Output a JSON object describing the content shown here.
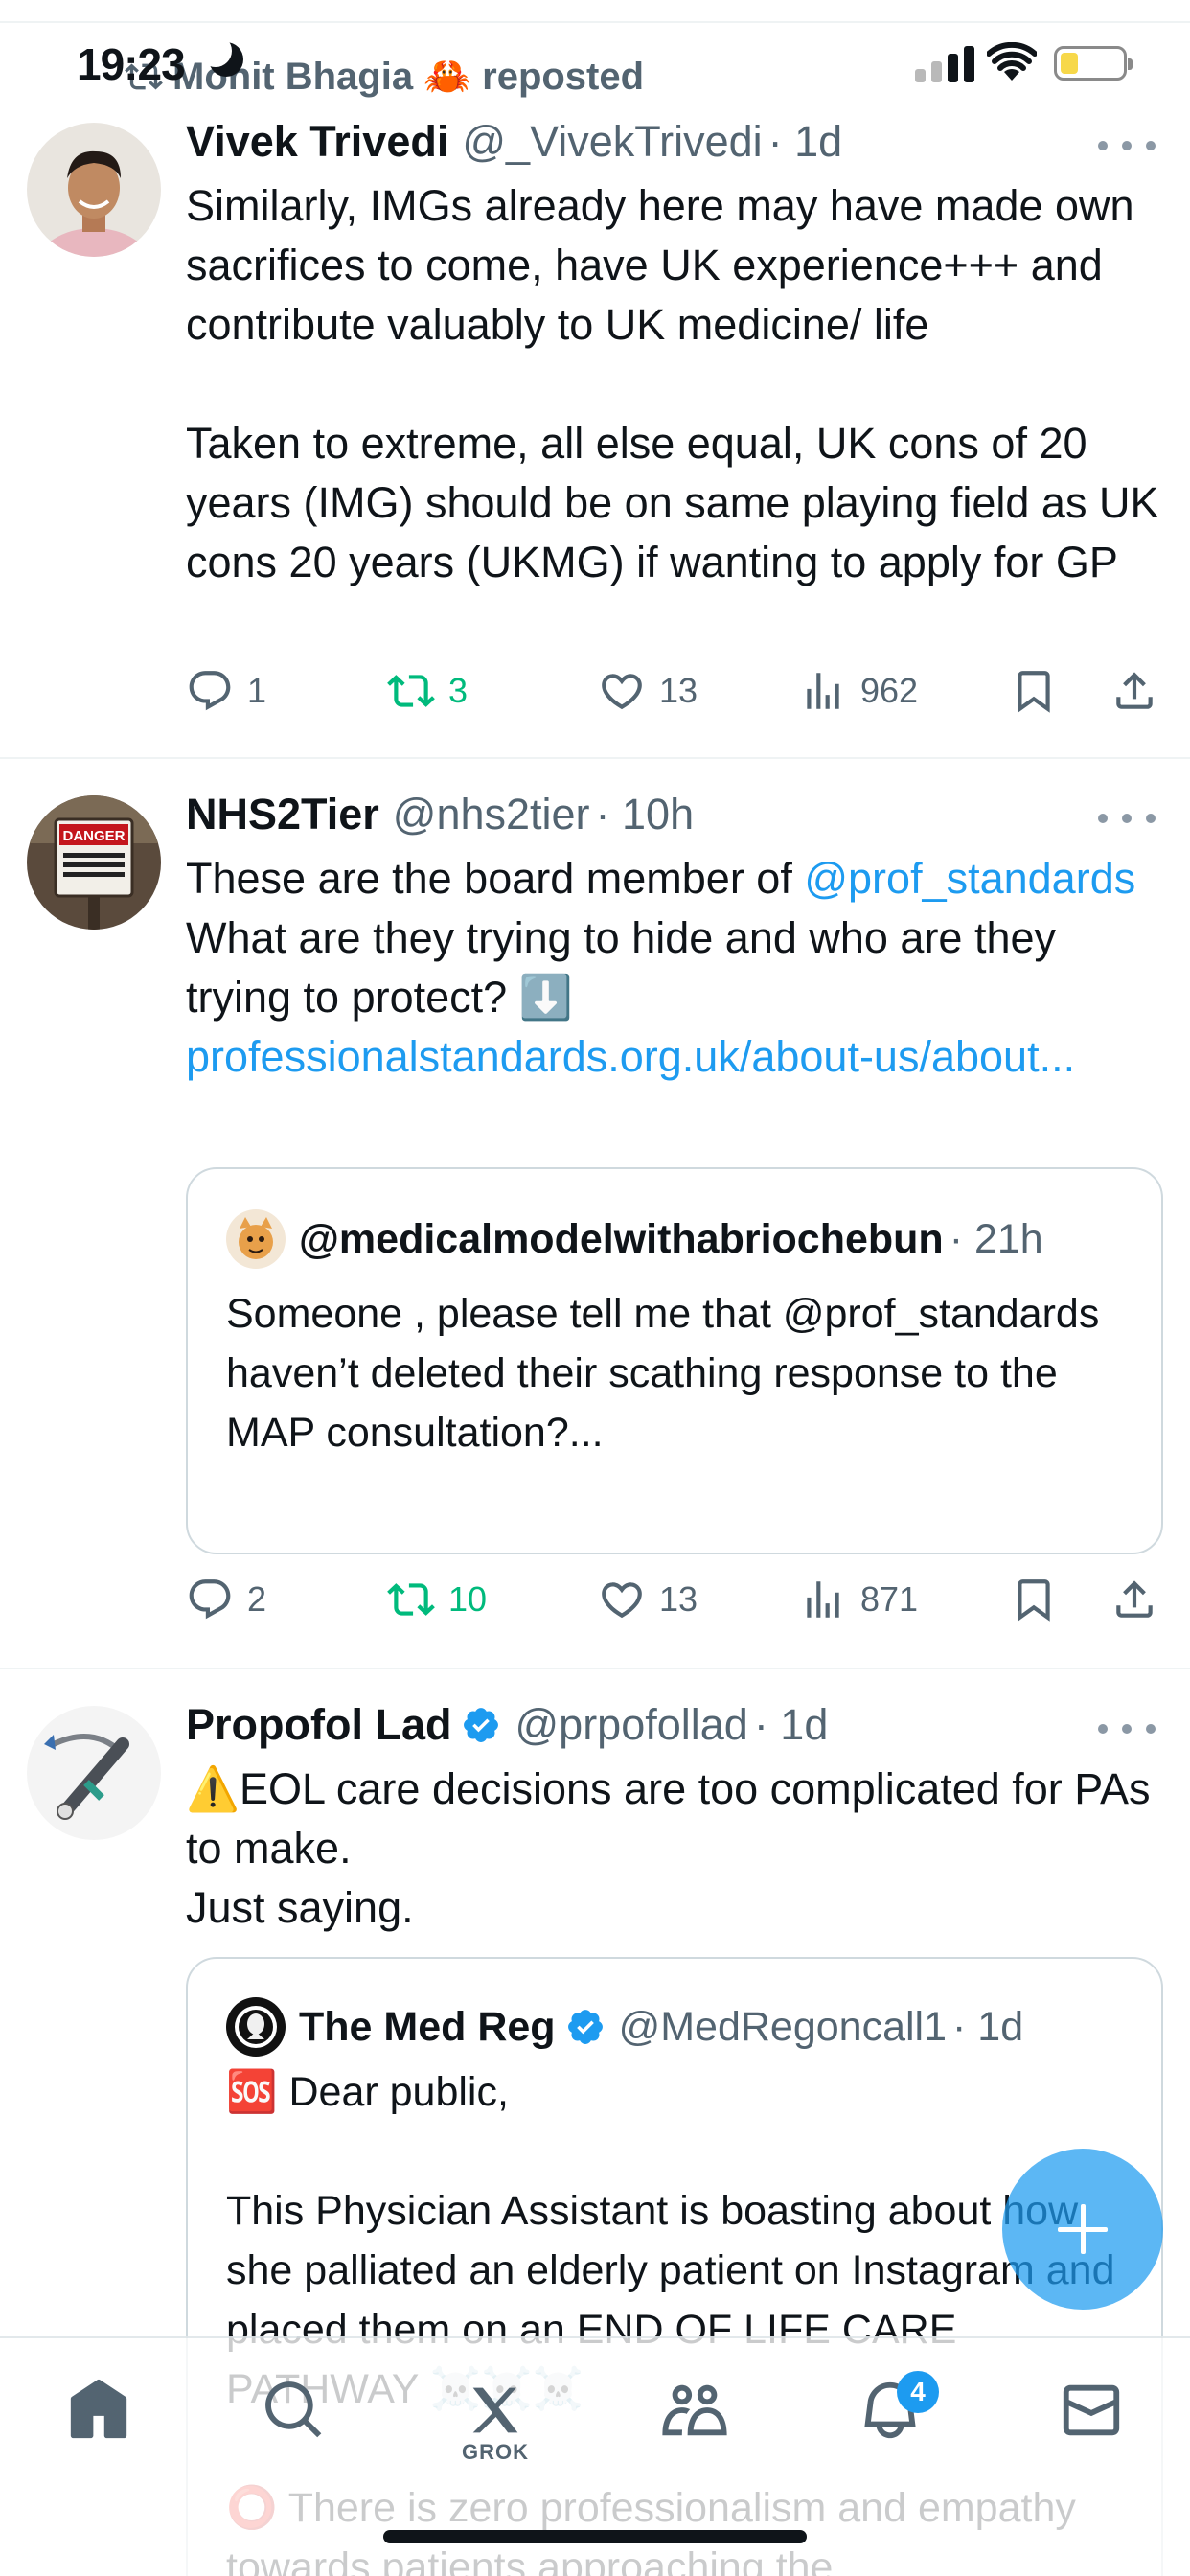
{
  "status_bar": {
    "time": "19:23"
  },
  "repost_banner": {
    "text": "Mohit Bhagia 🦀 reposted"
  },
  "posts": [
    {
      "name": "Vivek Trivedi",
      "handle": "@_VivekTrivedi",
      "time": "· 1d",
      "text": "Similarly, IMGs already here may have made own sacrifices to come, have UK experience+++ and contribute valuably to UK medicine/ life\n\nTaken to extreme, all else equal, UK cons of 20 years (IMG) should be on same playing field as UK cons 20 years (UKMG) if wanting to apply for GP",
      "replies": "1",
      "reposts": "3",
      "likes": "13",
      "views": "962"
    },
    {
      "name": "NHS2Tier",
      "handle": "@nhs2tier",
      "time": "· 10h",
      "text_before": "These are the board member of ",
      "mention": "@prof_standards",
      "text_after": " What are they trying to hide and who are they trying to protect? ⬇️",
      "link": "professionalstandards.org.uk/about-us/about...",
      "quote": {
        "handle": "@medicalmodelwithabriochebun",
        "time": "· 21h",
        "text": "Someone , please tell me that @prof_standards haven’t deleted their scathing response to the MAP consultation?..."
      },
      "replies": "2",
      "reposts": "10",
      "likes": "13",
      "views": "871"
    },
    {
      "name": "Propofol Lad",
      "handle": "@prpofollad",
      "time": "· 1d",
      "text": "⚠️EOL care decisions are too complicated for PAs to make.\nJust saying.",
      "quote": {
        "name": "The Med Reg",
        "handle": "@MedRegoncall1",
        "time": "· 1d",
        "text": "🆘 Dear public,\n\nThis Physician Assistant is boasting about how she palliated an elderly patient on Instagram and placed them on an END OF LIFE CARE PATHWAY ☠️☠️☠️\n\n⭕ There is zero professionalism and empathy towards patients approaching the"
      }
    }
  ],
  "tabbar": {
    "grok_label": "GROK",
    "notifications_badge": "4"
  },
  "colors": {
    "accent": "#1d9bf0",
    "repost_green": "#00ba7c",
    "muted": "#536471"
  },
  "icons": [
    "reply-icon",
    "repost-icon",
    "like-icon",
    "views-icon",
    "bookmark-icon",
    "share-icon",
    "home-icon",
    "search-icon",
    "grok-icon",
    "communities-icon",
    "notifications-icon",
    "messages-icon"
  ]
}
